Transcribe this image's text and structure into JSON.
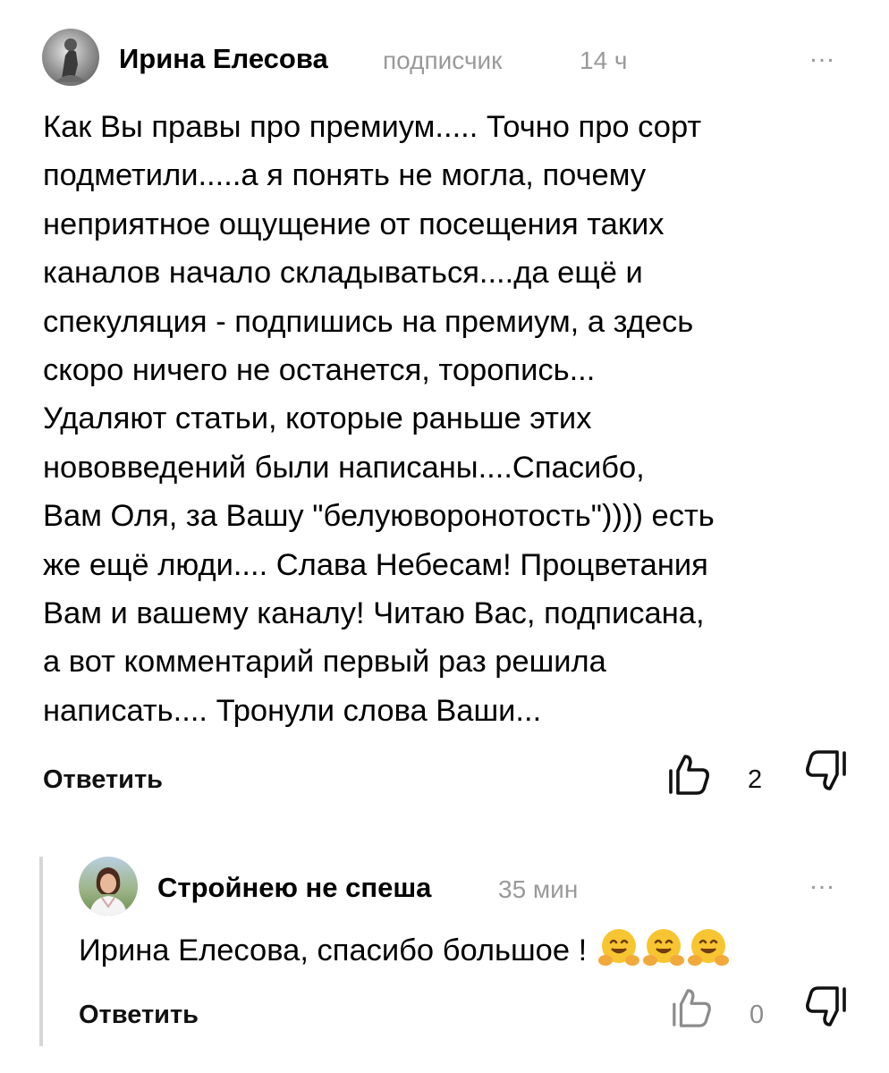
{
  "comment": {
    "author": "Ирина Елесова",
    "role": "подписчик",
    "time": "14 ч",
    "more": "…",
    "text": "Как Вы правы про премиум..... Точно про сорт\nподметили.....а я понять не могла, почему\nнеприятное ощущение от посещения таких\nканалов начало складываться....да ещё и\nспекуляция - подпишись на премиум, а здесь\nскоро ничего не останется, торопись...\nУдаляют статьи, которые раньше этих\nнововведений были написаны....Спасибо,\nВам Оля, за Вашу \"белуюворонотость\")))) есть\nже ещё люди.... Слава Небесам! Процветания\nВам и вашему каналу! Читаю Вас, подписана,\nа вот комментарий первый раз решила\nнаписать.... Тронули слова Ваши...",
    "reply_label": "Ответить",
    "likes": "2"
  },
  "reply": {
    "author": "Стройнею не спеша",
    "time": "35 мин",
    "more": "…",
    "text": "Ирина Елесова, спасибо большое !",
    "emoji_icons": [
      "hugging-face-icon",
      "hugging-face-icon",
      "hugging-face-icon"
    ],
    "reply_label": "Ответить",
    "likes": "0"
  },
  "colors": {
    "meta": "#9a9a9a",
    "thread_line": "#d7d7d7",
    "emoji": "#f7c531"
  }
}
